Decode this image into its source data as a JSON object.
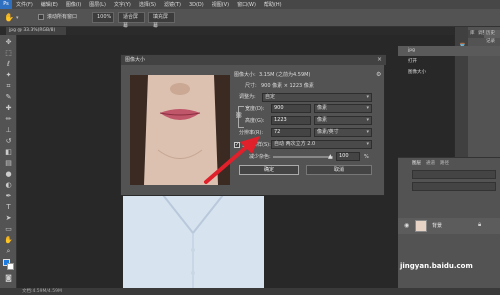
{
  "menubar": {
    "items": [
      "文件(F)",
      "编辑(E)",
      "图像(I)",
      "图层(L)",
      "文字(Y)",
      "选择(S)",
      "滤镜(T)",
      "3D(D)",
      "视图(V)",
      "窗口(W)",
      "帮助(H)"
    ]
  },
  "options": {
    "checkbox_label": "滚动所有窗口",
    "zoom": "100%",
    "fit_label": "适合屏幕",
    "fill_label": "填充屏幕"
  },
  "document": {
    "tab_label": "jpg @ 33.3%(RGB/8)"
  },
  "status": {
    "text": "文档:4.59M/4.59M"
  },
  "panels": {
    "tab_library": "库",
    "tab_adjust": "调整",
    "tab_history": "历史记录",
    "history_items": [
      "jpg",
      "打开",
      "图像大小"
    ],
    "layers_tab": "图层",
    "channels_tab": "通道",
    "paths_tab": "路径",
    "layer_name": "背景"
  },
  "dialog": {
    "title": "图像大小",
    "image_size_label": "图像大小:",
    "image_size_value": "3.15M (之前为4.59M)",
    "dimensions_label": "尺寸:",
    "dimensions_value": "900 像素 × 1223 像素",
    "fit_label": "调整为:",
    "fit_value": "自定",
    "width_label": "宽度(D):",
    "width_value": "900",
    "width_unit": "像素",
    "height_label": "高度(G):",
    "height_value": "1223",
    "height_unit": "像素",
    "resolution_label": "分辨率(R):",
    "resolution_value": "72",
    "resolution_unit": "像素/英寸",
    "resample_label": "重新采样(S):",
    "resample_value": "自动",
    "resample_method": "两次立方 2.0",
    "noise_label": "减少杂色:",
    "noise_value": "100",
    "noise_unit": "%",
    "ok_label": "确定",
    "cancel_label": "取消"
  },
  "watermark": "jingyan.baidu.com",
  "colors": {
    "accent": "#e0202a"
  }
}
